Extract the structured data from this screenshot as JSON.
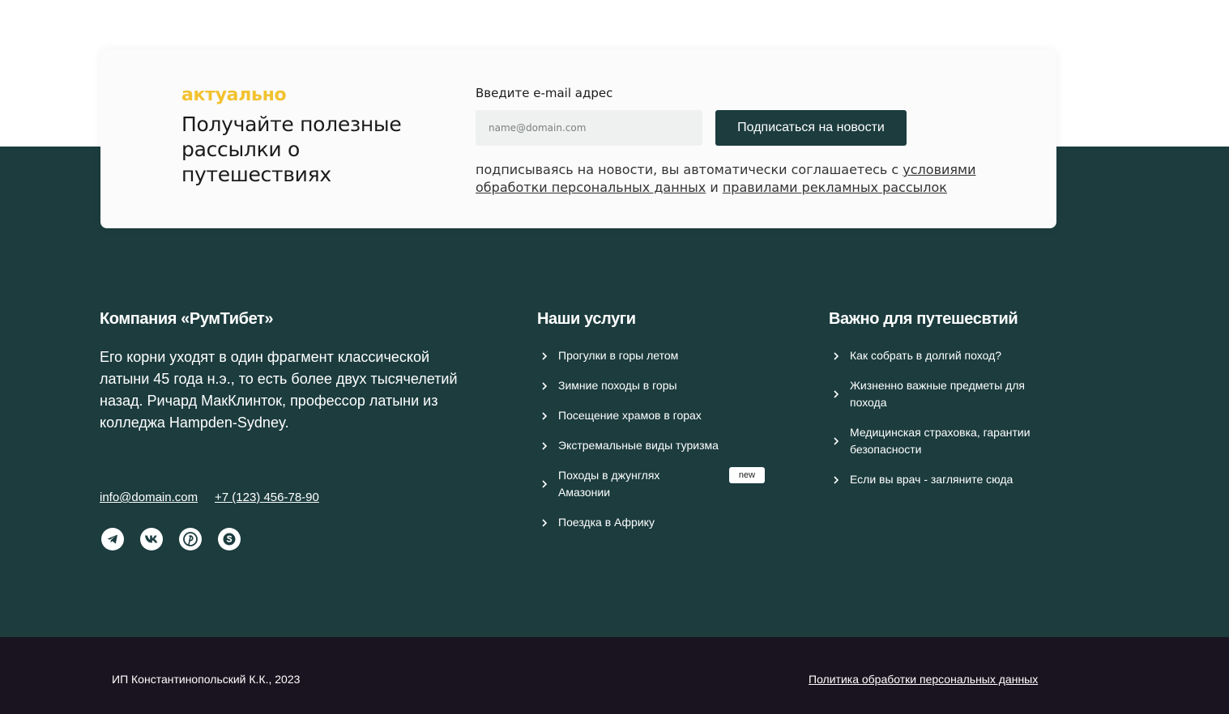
{
  "subscribe": {
    "kicker": "актуально",
    "title": "Получайте полезные рассылки о путешествиях",
    "email_label": "Введите e-mail адрес",
    "email_placeholder": "name@domain.com",
    "email_value": "",
    "button_label": "Подписаться на новости",
    "consent_prefix": "подписываясь на новости, вы автоматически соглашаетесь с ",
    "consent_link1": "условиями обработки персональных данных",
    "consent_middle": " и ",
    "consent_link2": "правилами рекламных рассылок"
  },
  "about": {
    "title": "Компания «РумТибет»",
    "text": "Его корни уходят в один фрагмент классической латыни 45 года н.э., то есть более двух тысячелетий назад. Ричард МакКлинток, профессор латыни из колледжа Hampden-Sydney.",
    "email": "info@domain.com",
    "phone": "+7 (123) 456-78-90",
    "socials": [
      "telegram-icon",
      "vk-icon",
      "pinterest-icon",
      "skype-icon"
    ]
  },
  "services": {
    "title": "Наши услуги",
    "items": [
      "Прогулки в горы летом",
      "Зимние походы в горы",
      "Посещение храмов в горах",
      "Экстремальные виды туризма",
      "Походы в джунглях Амазонии",
      "Поездка в Африку"
    ],
    "badge": "new"
  },
  "important": {
    "title": "Важно для путешесвтий",
    "items": [
      "Как собрать в долгий поход?",
      "Жизненно важные предметы для похода",
      "Медицинская страховка, гарантии безопасности",
      "Если вы врач - загляните сюда"
    ]
  },
  "bottom": {
    "copyright": "ИП Константинопольский К.К., 2023",
    "policy": "Политика обработки персональных данных"
  },
  "colors": {
    "accent": "#f2c230",
    "footer_green": "#1c3c3e",
    "bottom_bar": "#1a1420"
  }
}
